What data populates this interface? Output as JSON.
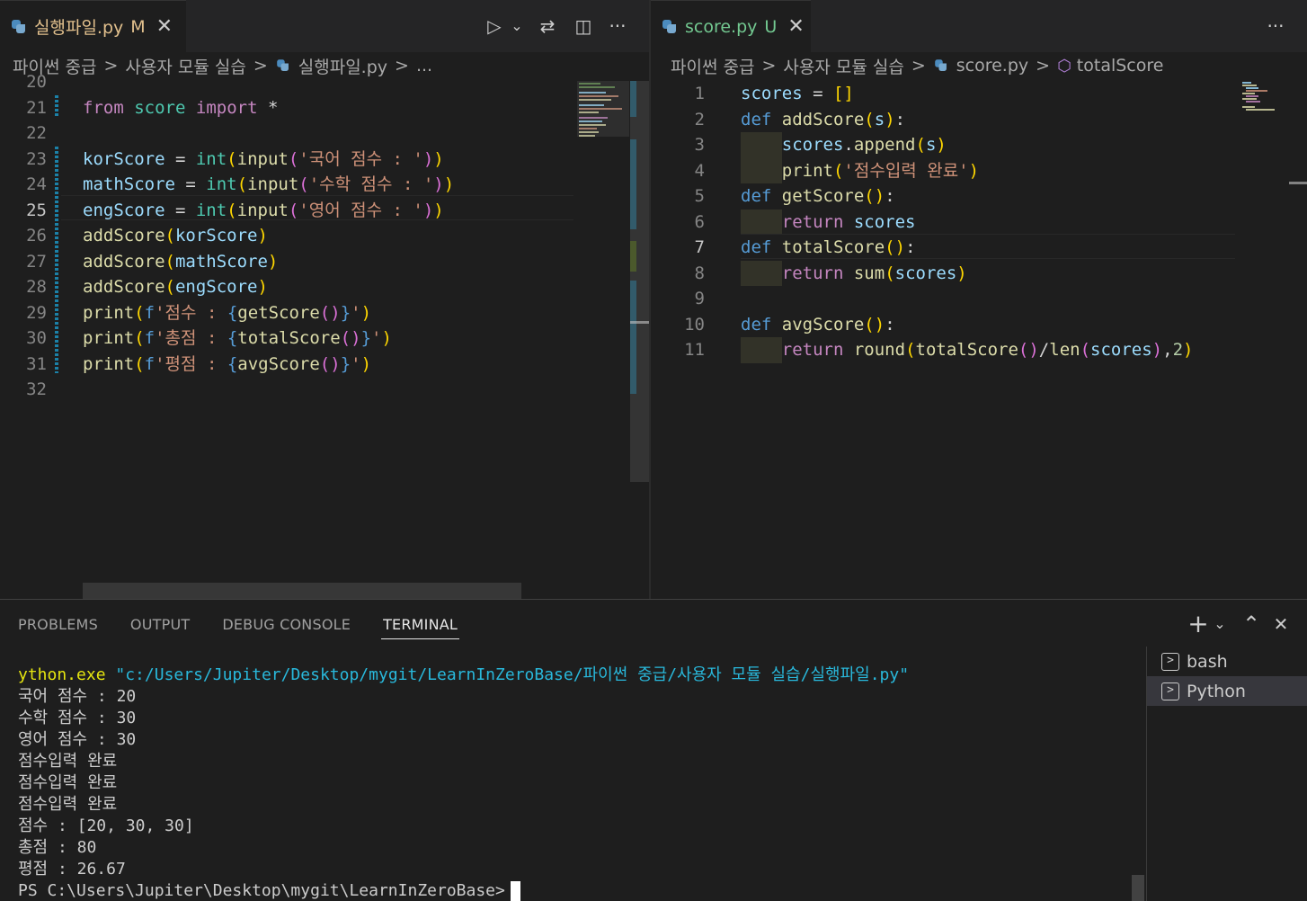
{
  "left_editor": {
    "tab": {
      "title": "실행파일.py",
      "status": "M",
      "close": "✕"
    },
    "toolbar": {
      "run": "▷",
      "run_menu": "⌄",
      "compare": "⇄",
      "split": "◫",
      "more": "···"
    },
    "breadcrumb": [
      "파이썬 중급",
      "사용자 모듈 실습",
      "실행파일.py",
      "..."
    ],
    "lines": [
      {
        "n": "20",
        "tokens": []
      },
      {
        "n": "21",
        "tokens": [
          {
            "t": "from",
            "c": "kw"
          },
          {
            "t": " "
          },
          {
            "t": "score",
            "c": "bi"
          },
          {
            "t": " "
          },
          {
            "t": "import",
            "c": "kw"
          },
          {
            "t": " *",
            "c": "op"
          }
        ]
      },
      {
        "n": "22",
        "tokens": []
      },
      {
        "n": "23",
        "tokens": [
          {
            "t": "korScore",
            "c": "var"
          },
          {
            "t": " = ",
            "c": "op"
          },
          {
            "t": "int",
            "c": "bi"
          },
          {
            "t": "(",
            "c": "p1"
          },
          {
            "t": "input",
            "c": "fn"
          },
          {
            "t": "(",
            "c": "p2"
          },
          {
            "t": "'국어 점수 : '",
            "c": "str"
          },
          {
            "t": ")",
            "c": "p2"
          },
          {
            "t": ")",
            "c": "p1"
          }
        ]
      },
      {
        "n": "24",
        "tokens": [
          {
            "t": "mathScore",
            "c": "var"
          },
          {
            "t": " = ",
            "c": "op"
          },
          {
            "t": "int",
            "c": "bi"
          },
          {
            "t": "(",
            "c": "p1"
          },
          {
            "t": "input",
            "c": "fn"
          },
          {
            "t": "(",
            "c": "p2"
          },
          {
            "t": "'수학 점수 : '",
            "c": "str"
          },
          {
            "t": ")",
            "c": "p2"
          },
          {
            "t": ")",
            "c": "p1"
          }
        ]
      },
      {
        "n": "25",
        "active": true,
        "tokens": [
          {
            "t": "engScore",
            "c": "var"
          },
          {
            "t": " = ",
            "c": "op"
          },
          {
            "t": "int",
            "c": "bi"
          },
          {
            "t": "(",
            "c": "p1"
          },
          {
            "t": "input",
            "c": "fn"
          },
          {
            "t": "(",
            "c": "p2"
          },
          {
            "t": "'영어 점수 : '",
            "c": "str"
          },
          {
            "t": ")",
            "c": "p2"
          },
          {
            "t": ")",
            "c": "p1"
          }
        ]
      },
      {
        "n": "26",
        "tokens": [
          {
            "t": "addScore",
            "c": "fn"
          },
          {
            "t": "(",
            "c": "p1"
          },
          {
            "t": "korScore",
            "c": "var"
          },
          {
            "t": ")",
            "c": "p1"
          }
        ]
      },
      {
        "n": "27",
        "tokens": [
          {
            "t": "addScore",
            "c": "fn"
          },
          {
            "t": "(",
            "c": "p1"
          },
          {
            "t": "mathScore",
            "c": "var"
          },
          {
            "t": ")",
            "c": "p1"
          }
        ]
      },
      {
        "n": "28",
        "tokens": [
          {
            "t": "addScore",
            "c": "fn"
          },
          {
            "t": "(",
            "c": "p1"
          },
          {
            "t": "engScore",
            "c": "var"
          },
          {
            "t": ")",
            "c": "p1"
          }
        ]
      },
      {
        "n": "29",
        "tokens": [
          {
            "t": "print",
            "c": "fn"
          },
          {
            "t": "(",
            "c": "p1"
          },
          {
            "t": "f",
            "c": "def"
          },
          {
            "t": "'점수 : ",
            "c": "str"
          },
          {
            "t": "{",
            "c": "def"
          },
          {
            "t": "getScore",
            "c": "fn"
          },
          {
            "t": "()",
            "c": "p2"
          },
          {
            "t": "}",
            "c": "def"
          },
          {
            "t": "'",
            "c": "str"
          },
          {
            "t": ")",
            "c": "p1"
          }
        ]
      },
      {
        "n": "30",
        "tokens": [
          {
            "t": "print",
            "c": "fn"
          },
          {
            "t": "(",
            "c": "p1"
          },
          {
            "t": "f",
            "c": "def"
          },
          {
            "t": "'총점 : ",
            "c": "str"
          },
          {
            "t": "{",
            "c": "def"
          },
          {
            "t": "totalScore",
            "c": "fn"
          },
          {
            "t": "()",
            "c": "p2"
          },
          {
            "t": "}",
            "c": "def"
          },
          {
            "t": "'",
            "c": "str"
          },
          {
            "t": ")",
            "c": "p1"
          }
        ]
      },
      {
        "n": "31",
        "tokens": [
          {
            "t": "print",
            "c": "fn"
          },
          {
            "t": "(",
            "c": "p1"
          },
          {
            "t": "f",
            "c": "def"
          },
          {
            "t": "'평점 : ",
            "c": "str"
          },
          {
            "t": "{",
            "c": "def"
          },
          {
            "t": "avgScore",
            "c": "fn"
          },
          {
            "t": "()",
            "c": "p2"
          },
          {
            "t": "}",
            "c": "def"
          },
          {
            "t": "'",
            "c": "str"
          },
          {
            "t": ")",
            "c": "p1"
          }
        ]
      },
      {
        "n": "32",
        "tokens": []
      }
    ]
  },
  "right_editor": {
    "tab": {
      "title": "score.py",
      "status": "U",
      "close": "✕"
    },
    "toolbar": {
      "more": "···"
    },
    "breadcrumb": [
      "파이썬 중급",
      "사용자 모듈 실습",
      "score.py",
      "totalScore"
    ],
    "lines": [
      {
        "n": "1",
        "tokens": [
          {
            "t": "scores",
            "c": "var"
          },
          {
            "t": " = ",
            "c": "op"
          },
          {
            "t": "[]",
            "c": "p1"
          }
        ]
      },
      {
        "n": "2",
        "tokens": [
          {
            "t": "def",
            "c": "def"
          },
          {
            "t": " "
          },
          {
            "t": "addScore",
            "c": "fn"
          },
          {
            "t": "(",
            "c": "p1"
          },
          {
            "t": "s",
            "c": "var"
          },
          {
            "t": ")",
            "c": "p1"
          },
          {
            "t": ":",
            "c": "op"
          }
        ]
      },
      {
        "n": "3",
        "tokens": [
          {
            "t": "    "
          },
          {
            "t": "scores",
            "c": "var"
          },
          {
            "t": ".",
            "c": "op"
          },
          {
            "t": "append",
            "c": "fn"
          },
          {
            "t": "(",
            "c": "p1"
          },
          {
            "t": "s",
            "c": "var"
          },
          {
            "t": ")",
            "c": "p1"
          }
        ]
      },
      {
        "n": "4",
        "tokens": [
          {
            "t": "    "
          },
          {
            "t": "print",
            "c": "fn"
          },
          {
            "t": "(",
            "c": "p1"
          },
          {
            "t": "'점수입력 완료'",
            "c": "str"
          },
          {
            "t": ")",
            "c": "p1"
          }
        ]
      },
      {
        "n": "5",
        "tokens": [
          {
            "t": "def",
            "c": "def"
          },
          {
            "t": " "
          },
          {
            "t": "getScore",
            "c": "fn"
          },
          {
            "t": "()",
            "c": "p1"
          },
          {
            "t": ":",
            "c": "op"
          }
        ]
      },
      {
        "n": "6",
        "tokens": [
          {
            "t": "    "
          },
          {
            "t": "return",
            "c": "kw"
          },
          {
            "t": " "
          },
          {
            "t": "scores",
            "c": "var"
          }
        ]
      },
      {
        "n": "7",
        "active": true,
        "tokens": [
          {
            "t": "def",
            "c": "def"
          },
          {
            "t": " "
          },
          {
            "t": "totalScore",
            "c": "fn"
          },
          {
            "t": "()",
            "c": "p1"
          },
          {
            "t": ":",
            "c": "op"
          }
        ]
      },
      {
        "n": "8",
        "tokens": [
          {
            "t": "    "
          },
          {
            "t": "return",
            "c": "kw"
          },
          {
            "t": " "
          },
          {
            "t": "sum",
            "c": "fn"
          },
          {
            "t": "(",
            "c": "p1"
          },
          {
            "t": "scores",
            "c": "var"
          },
          {
            "t": ")",
            "c": "p1"
          }
        ]
      },
      {
        "n": "9",
        "tokens": []
      },
      {
        "n": "10",
        "tokens": [
          {
            "t": "def",
            "c": "def"
          },
          {
            "t": " "
          },
          {
            "t": "avgScore",
            "c": "fn"
          },
          {
            "t": "()",
            "c": "p1"
          },
          {
            "t": ":",
            "c": "op"
          }
        ]
      },
      {
        "n": "11",
        "tokens": [
          {
            "t": "    "
          },
          {
            "t": "return",
            "c": "kw"
          },
          {
            "t": " "
          },
          {
            "t": "round",
            "c": "fn"
          },
          {
            "t": "(",
            "c": "p1"
          },
          {
            "t": "totalScore",
            "c": "fn"
          },
          {
            "t": "()",
            "c": "p2"
          },
          {
            "t": "/",
            "c": "op"
          },
          {
            "t": "len",
            "c": "fn"
          },
          {
            "t": "(",
            "c": "p2"
          },
          {
            "t": "scores",
            "c": "var"
          },
          {
            "t": ")",
            "c": "p2"
          },
          {
            "t": ",",
            "c": "op"
          },
          {
            "t": "2",
            "c": "num"
          },
          {
            "t": ")",
            "c": "p1"
          }
        ]
      }
    ]
  },
  "panel": {
    "tabs": [
      "PROBLEMS",
      "OUTPUT",
      "DEBUG CONSOLE",
      "TERMINAL"
    ],
    "active_tab": "TERMINAL",
    "actions": {
      "new_terminal": "+",
      "launch_profile": "⌄",
      "maximize": "⌃",
      "close": "✕"
    },
    "terminal_lines": [
      {
        "parts": [
          {
            "t": "ython.exe",
            "c": "t-yellow"
          },
          {
            "t": " \"c:/Users/Jupiter/Desktop/mygit/LearnInZeroBase/파이썬 중급/사용자 모듈 실습/실행파일.py\"",
            "c": "t-cyan"
          }
        ]
      },
      {
        "parts": [
          {
            "t": "국어 점수 : 20"
          }
        ]
      },
      {
        "parts": [
          {
            "t": "수학 점수 : 30"
          }
        ]
      },
      {
        "parts": [
          {
            "t": "영어 점수 : 30"
          }
        ]
      },
      {
        "parts": [
          {
            "t": "점수입력 완료"
          }
        ]
      },
      {
        "parts": [
          {
            "t": "점수입력 완료"
          }
        ]
      },
      {
        "parts": [
          {
            "t": "점수입력 완료"
          }
        ]
      },
      {
        "parts": [
          {
            "t": "점수 : [20, 30, 30]"
          }
        ]
      },
      {
        "parts": [
          {
            "t": "총점 : 80"
          }
        ]
      },
      {
        "parts": [
          {
            "t": "평점 : 26.67"
          }
        ]
      },
      {
        "parts": [
          {
            "t": "PS C:\\Users\\Jupiter\\Desktop\\mygit\\LearnInZeroBase>"
          }
        ],
        "cursor": true
      }
    ],
    "terminals": [
      {
        "name": "bash",
        "icon": ">"
      },
      {
        "name": "Python",
        "icon": ">",
        "selected": true
      }
    ]
  },
  "colors": {
    "background": "#1e1e1e",
    "tab_modified": "#e2c08d",
    "tab_untracked": "#73c991",
    "accent": "#569cd6"
  }
}
